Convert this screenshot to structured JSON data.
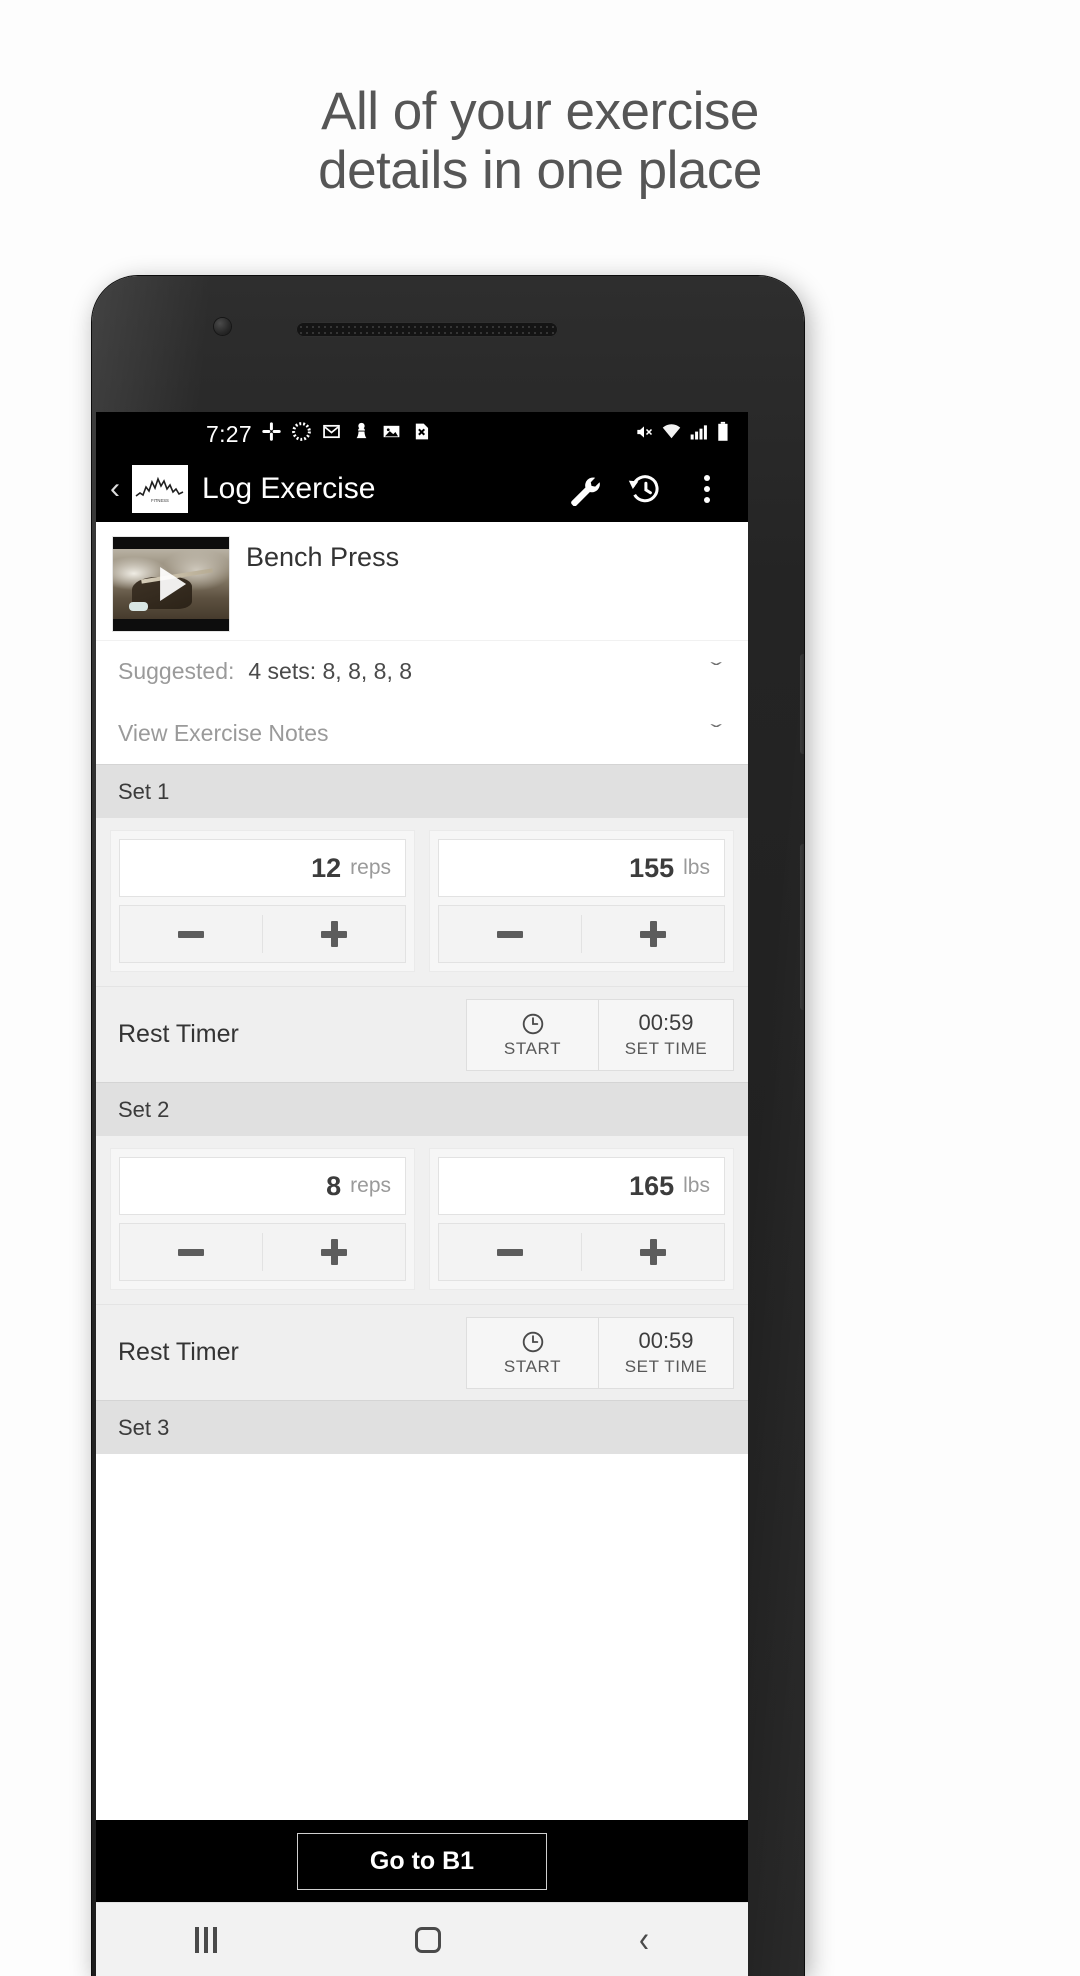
{
  "marketing": {
    "headline_line1": "All of your exercise",
    "headline_line2": "details in one place"
  },
  "statusbar": {
    "time": "7:27",
    "left_icons": [
      "slack-icon",
      "sync-progress-icon",
      "gmail-icon",
      "chess-pawn-icon",
      "photo-icon",
      "file-x-icon"
    ],
    "right_icons": [
      "mute-icon",
      "wifi-icon",
      "signal-icon",
      "battery-icon"
    ]
  },
  "appbar": {
    "back_label": "‹",
    "logo_name": "app-logo",
    "title": "Log Exercise",
    "action_wrench": "wrench-icon",
    "action_history": "history-icon",
    "action_overflow": "overflow-menu-icon"
  },
  "exercise": {
    "name": "Bench Press",
    "video_thumb_name": "exercise-video-thumbnail",
    "suggested_label": "Suggested:",
    "suggested_value": "4 sets: 8, 8, 8, 8",
    "notes_label": "View Exercise Notes",
    "chevron": "ˇ"
  },
  "sets": [
    {
      "header": "Set 1",
      "reps_value": "12",
      "reps_unit": "reps",
      "weight_value": "155",
      "weight_unit": "lbs"
    },
    {
      "header": "Set 2",
      "reps_value": "8",
      "reps_unit": "reps",
      "weight_value": "165",
      "weight_unit": "lbs"
    }
  ],
  "set3_header": "Set 3",
  "rest_timer": {
    "label": "Rest Timer",
    "start_caption": "START",
    "time_value": "00:59",
    "set_time_caption": "SET TIME",
    "clock_icon": "clock-icon"
  },
  "bottom": {
    "goto_label": "Go to B1"
  },
  "navbar": {
    "recents": "recents-icon",
    "home": "home-icon",
    "back": "‹"
  },
  "colors": {
    "appbar_bg": "#000000",
    "set_header_bg": "#e0e0e0",
    "page_bg": "#fdfdfd",
    "headline_color": "#565656"
  }
}
